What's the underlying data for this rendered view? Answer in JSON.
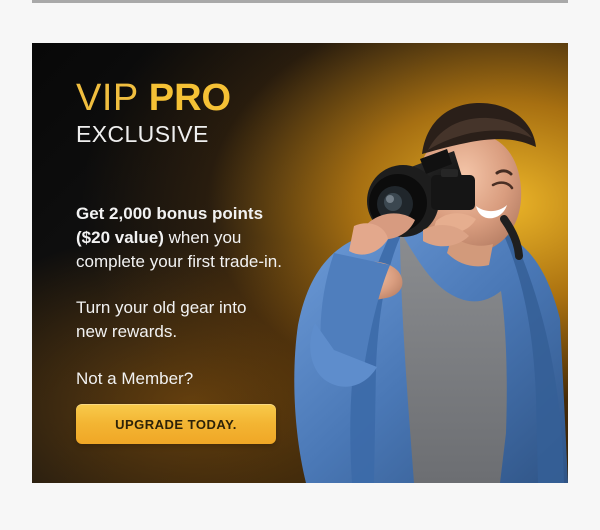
{
  "promo": {
    "vip": "VIP",
    "pro": "PRO",
    "exclusive": "EXCLUSIVE",
    "offer_strong_line_1": "Get 2,000 bonus points",
    "offer_strong_line_2": "($20 value)",
    "offer_rest_line_2": " when you",
    "offer_line_3": "complete your first trade-in.",
    "gear_line_1": "Turn your old gear into",
    "gear_line_2": "new rewards.",
    "member_prompt": "Not a Member?",
    "button_label": "UPGRADE TODAY."
  },
  "colors": {
    "gold": "#f5c135",
    "button_gold": "#f3b533",
    "background_dark": "#121212",
    "denim": "#4a78b6"
  }
}
